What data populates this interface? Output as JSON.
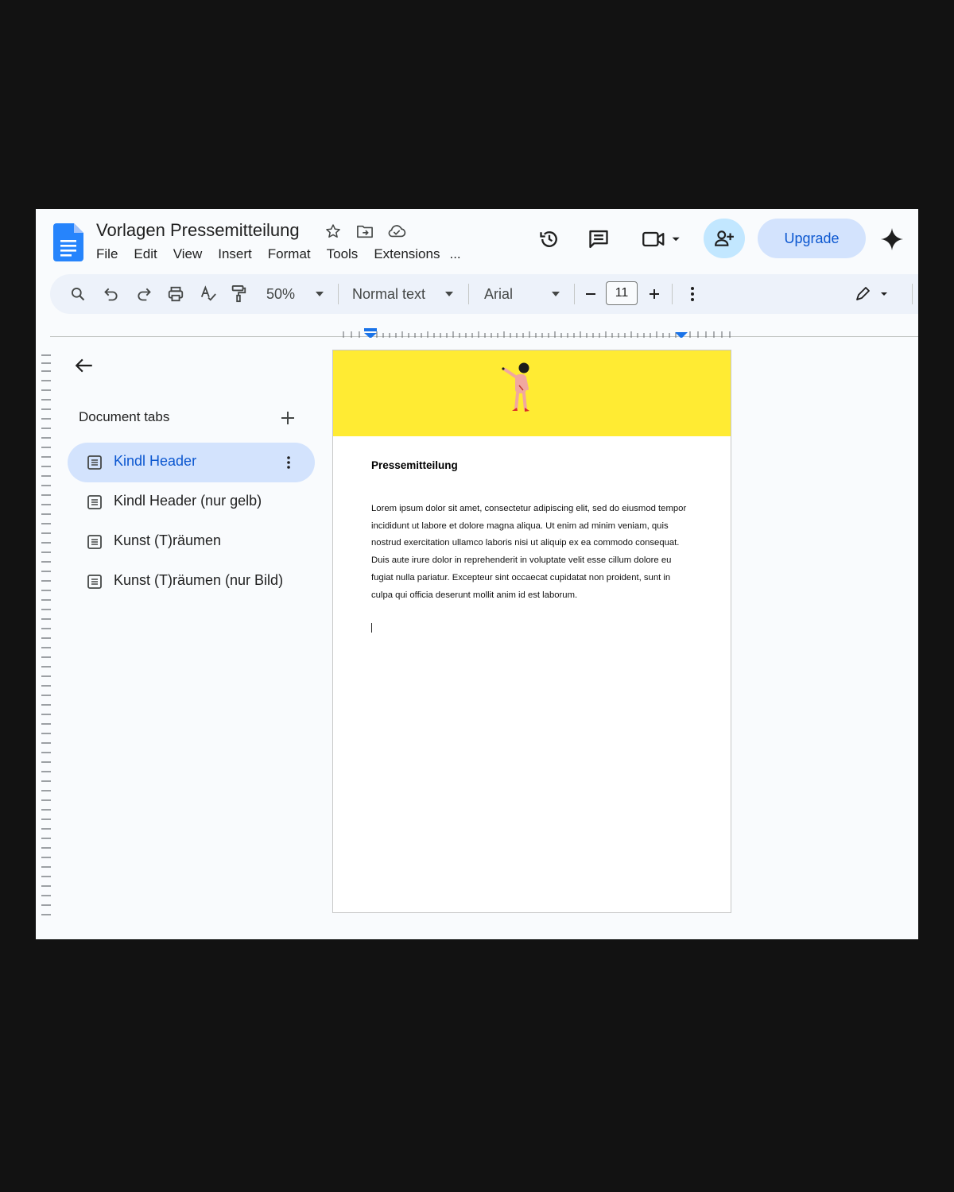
{
  "header": {
    "title": "Vorlagen Pressemitteilung",
    "menu": [
      "File",
      "Edit",
      "View",
      "Insert",
      "Format",
      "Tools",
      "Extensions",
      "..."
    ],
    "upgrade_label": "Upgrade"
  },
  "toolbar": {
    "zoom": "50%",
    "style": "Normal text",
    "font": "Arial",
    "font_size": "11"
  },
  "sidebar": {
    "heading": "Document tabs",
    "tabs": [
      {
        "label": "Kindl Header",
        "active": true
      },
      {
        "label": "Kindl Header (nur gelb)",
        "active": false
      },
      {
        "label": "Kunst (T)räumen",
        "active": false
      },
      {
        "label": "Kunst (T)räumen (nur Bild)",
        "active": false
      }
    ]
  },
  "document": {
    "heading": "Pressemitteilung",
    "body": "Lorem ipsum dolor sit amet, consectetur adipiscing elit, sed do eiusmod tempor incididunt ut labore et dolore magna aliqua. Ut enim ad minim veniam, quis nostrud exercitation ullamco laboris nisi ut aliquip ex ea commodo consequat. Duis aute irure dolor in reprehenderit in voluptate velit esse cillum dolore eu fugiat nulla pariatur. Excepteur sint occaecat cupidatat non proident, sunt in culpa qui officia deserunt mollit anim id est laborum.",
    "banner_color": "#ffeb33"
  },
  "icons": {
    "app": "google-docs-icon",
    "title_icons": [
      "star-icon",
      "move-to-folder-icon",
      "cloud-saved-icon"
    ],
    "header_icons": [
      "version-history-icon",
      "comments-icon",
      "meet-icon",
      "share-icon",
      "gemini-icon"
    ],
    "toolbar_icons": [
      "search-icon",
      "undo-icon",
      "redo-icon",
      "print-icon",
      "spellcheck-icon",
      "paint-format-icon",
      "more-vert-icon",
      "edit-mode-icon"
    ]
  },
  "colors": {
    "accent": "#0b57d0",
    "share_bg": "#c2e7ff",
    "upgrade_bg": "#d3e3fd",
    "page_bg": "#f9fbfd"
  }
}
